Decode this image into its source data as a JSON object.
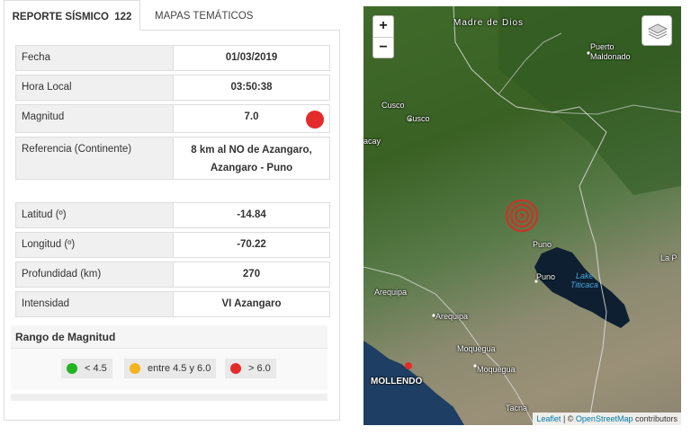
{
  "tabs": {
    "reporte_label": "REPORTE SÍSMICO",
    "reporte_count": "122",
    "mapas_label": "MAPAS TEMÁTICOS"
  },
  "report": {
    "fecha_label": "Fecha",
    "fecha_value": "01/03/2019",
    "hora_label": "Hora Local",
    "hora_value": "03:50:38",
    "magnitud_label": "Magnitud",
    "magnitud_value": "7.0",
    "referencia_label": "Referencia (Continente)",
    "referencia_value_line1": "8 km al NO de Azangaro,",
    "referencia_value_line2": "Azangaro - Puno",
    "latitud_label": "Latitud (º)",
    "latitud_value": "-14.84",
    "longitud_label": "Longitud (º)",
    "longitud_value": "-70.22",
    "profundidad_label": "Profundidad (km)",
    "profundidad_value": "270",
    "intensidad_label": "Intensidad",
    "intensidad_value": "VI Azangaro"
  },
  "rango": {
    "title": "Rango de Magnitud",
    "low_label": "< 4.5",
    "mid_label": "entre 4.5 y 6.0",
    "high_label": "> 6.0",
    "low_color": "#22b522",
    "mid_color": "#f5b320",
    "high_color": "#e32b2b"
  },
  "map": {
    "zoom_in": "+",
    "zoom_out": "−",
    "layers_icon": "layers-icon",
    "places": {
      "madre_de_dios": "Madre de Dios",
      "puerto": "Puerto",
      "maldonado": "Maldonado",
      "cusco_region": "Cusco",
      "cusco_city": "Cusco",
      "acay": "acay",
      "puno_region": "Puno",
      "puno_city": "Puno",
      "lake": "Lake",
      "titicaca": "Titicaca",
      "la_p": "La P",
      "arequipa_region": "Arequipa",
      "arequipa_city": "Arequipa",
      "moquegua_region": "Moquegua",
      "moquegua_city": "Moquegua",
      "mollendo": "MOLLENDO",
      "tacna": "Tacna"
    },
    "attribution_leaflet": "Leaflet",
    "attribution_sep": " | © ",
    "attribution_osm": "OpenStreetMap",
    "attribution_tail": " contributors"
  }
}
